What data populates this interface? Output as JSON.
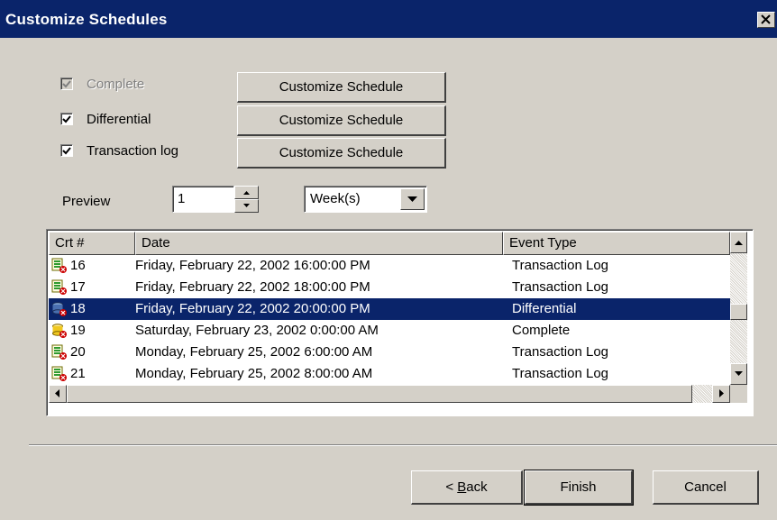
{
  "window": {
    "title": "Customize Schedules"
  },
  "options": [
    {
      "label": "Complete",
      "checked": true,
      "disabled": true,
      "button": "Customize Schedule"
    },
    {
      "label": "Differential",
      "checked": true,
      "disabled": false,
      "button": "Customize Schedule"
    },
    {
      "label": "Transaction log",
      "checked": true,
      "disabled": false,
      "button": "Customize Schedule"
    }
  ],
  "preview": {
    "label": "Preview",
    "value": "1",
    "unit": "Week(s)"
  },
  "list": {
    "columns": [
      "Crt #",
      "Date",
      "Event Type"
    ],
    "rows": [
      {
        "num": "16",
        "date": "Friday, February 22, 2002 16:00:00 PM",
        "event": "Transaction Log",
        "icon": "transaction-log-icon",
        "selected": false
      },
      {
        "num": "17",
        "date": "Friday, February 22, 2002 18:00:00 PM",
        "event": "Transaction Log",
        "icon": "transaction-log-icon",
        "selected": false
      },
      {
        "num": "18",
        "date": "Friday, February 22, 2002 20:00:00 PM",
        "event": "Differential",
        "icon": "differential-icon",
        "selected": true
      },
      {
        "num": "19",
        "date": "Saturday, February 23, 2002 0:00:00 AM",
        "event": "Complete",
        "icon": "complete-icon",
        "selected": false
      },
      {
        "num": "20",
        "date": "Monday, February 25, 2002 6:00:00 AM",
        "event": "Transaction Log",
        "icon": "transaction-log-icon",
        "selected": false
      },
      {
        "num": "21",
        "date": "Monday, February 25, 2002 8:00:00 AM",
        "event": "Transaction Log",
        "icon": "transaction-log-icon",
        "selected": false
      }
    ]
  },
  "footer": {
    "back_prefix": "< ",
    "back_accel": "B",
    "back_rest": "ack",
    "finish": "Finish",
    "cancel": "Cancel"
  }
}
